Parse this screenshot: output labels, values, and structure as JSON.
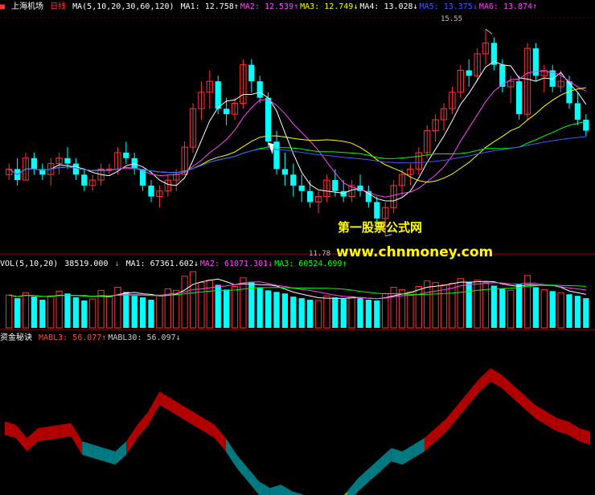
{
  "header": {
    "stock_name": "上海机场",
    "period": "日线",
    "ma_params": "MA(5,10,20,30,60,120)",
    "items": [
      {
        "label": "MA1:",
        "value": "12.758",
        "arrow": "↑",
        "color": "#ffffff"
      },
      {
        "label": "MA2:",
        "value": "12.539",
        "arrow": "↑",
        "color": "#ff44ff"
      },
      {
        "label": "MA3:",
        "value": "12.749",
        "arrow": "↓",
        "color": "#ffff00"
      },
      {
        "label": "MA4:",
        "value": "13.028",
        "arrow": "↓",
        "color": "#ffffff"
      },
      {
        "label": "MA5:",
        "value": "13.375",
        "arrow": "↓",
        "color": "#3a5cff"
      },
      {
        "label": "MA6:",
        "value": "13.874",
        "arrow": "↑",
        "color": "#ff44ff"
      }
    ]
  },
  "volume_header": {
    "params": "VOL(5,10,20)",
    "value": "38519.000",
    "arrow": "↓",
    "items": [
      {
        "label": "MA1:",
        "value": "67361.602",
        "arrow": "↓",
        "color": "#ffffff"
      },
      {
        "label": "MA2:",
        "value": "61071.301",
        "arrow": "↓",
        "color": "#ff44ff"
      },
      {
        "label": "MA3:",
        "value": "60524.699",
        "arrow": "↑",
        "color": "#00ff00"
      }
    ]
  },
  "indicator_header": {
    "name": "资金秘诀",
    "items": [
      {
        "label": "MABL3:",
        "value": "56.077",
        "arrow": "↑",
        "color": "#ff4444"
      },
      {
        "label": "MABL30:",
        "value": "56.097",
        "arrow": "↓",
        "color": "#cccccc"
      }
    ]
  },
  "annotations": {
    "high_label": "15.55",
    "low_label": "11.78"
  },
  "watermark": {
    "title": "第一股票公式网",
    "url": "www.chnmoney.com"
  },
  "colors": {
    "up": "#ff3333",
    "down": "#00ffff",
    "flow_red": "#b00000",
    "flow_teal": "#007a80",
    "flow_yellow": "#a0a000"
  },
  "chart_data": {
    "type": "candlestick",
    "price_low": 11.78,
    "price_high": 15.55,
    "ohlc": [
      [
        12.9,
        13.1,
        12.8,
        13.0
      ],
      [
        13.0,
        13.2,
        12.7,
        12.8
      ],
      [
        12.8,
        13.3,
        12.8,
        13.2
      ],
      [
        13.2,
        13.3,
        12.9,
        13.0
      ],
      [
        13.0,
        13.1,
        12.8,
        12.9
      ],
      [
        12.9,
        13.2,
        12.7,
        13.1
      ],
      [
        13.1,
        13.3,
        12.9,
        13.2
      ],
      [
        13.2,
        13.4,
        13.0,
        13.1
      ],
      [
        13.1,
        13.2,
        12.8,
        12.9
      ],
      [
        12.9,
        13.0,
        12.6,
        12.7
      ],
      [
        12.7,
        12.9,
        12.6,
        12.8
      ],
      [
        12.8,
        13.1,
        12.7,
        13.0
      ],
      [
        13.0,
        13.1,
        12.9,
        13.0
      ],
      [
        13.0,
        13.4,
        12.9,
        13.3
      ],
      [
        13.3,
        13.5,
        13.1,
        13.2
      ],
      [
        13.2,
        13.3,
        12.9,
        13.0
      ],
      [
        13.0,
        13.0,
        12.6,
        12.7
      ],
      [
        12.7,
        12.8,
        12.4,
        12.5
      ],
      [
        12.5,
        12.7,
        12.3,
        12.6
      ],
      [
        12.6,
        12.9,
        12.5,
        12.8
      ],
      [
        12.8,
        13.0,
        12.6,
        12.9
      ],
      [
        12.9,
        13.5,
        12.9,
        13.4
      ],
      [
        13.4,
        14.2,
        13.3,
        14.1
      ],
      [
        14.1,
        14.6,
        13.9,
        14.4
      ],
      [
        14.4,
        14.8,
        14.1,
        14.6
      ],
      [
        14.6,
        14.7,
        14.0,
        14.1
      ],
      [
        14.1,
        14.3,
        13.8,
        14.0
      ],
      [
        14.0,
        14.3,
        13.9,
        14.2
      ],
      [
        14.2,
        15.0,
        14.1,
        14.9
      ],
      [
        14.9,
        15.0,
        14.4,
        14.6
      ],
      [
        14.6,
        14.7,
        14.2,
        14.3
      ],
      [
        14.3,
        14.4,
        13.4,
        13.5
      ],
      [
        13.5,
        13.7,
        12.9,
        13.0
      ],
      [
        13.0,
        13.3,
        12.7,
        12.9
      ],
      [
        12.9,
        13.1,
        12.5,
        12.7
      ],
      [
        12.7,
        12.9,
        12.4,
        12.6
      ],
      [
        12.6,
        12.8,
        12.3,
        12.4
      ],
      [
        12.4,
        12.6,
        12.2,
        12.5
      ],
      [
        12.5,
        12.9,
        12.4,
        12.8
      ],
      [
        12.8,
        13.0,
        12.5,
        12.6
      ],
      [
        12.6,
        12.8,
        12.4,
        12.5
      ],
      [
        12.5,
        12.8,
        12.4,
        12.7
      ],
      [
        12.7,
        12.9,
        12.5,
        12.6
      ],
      [
        12.6,
        12.7,
        12.3,
        12.4
      ],
      [
        12.4,
        12.5,
        12.0,
        12.1
      ],
      [
        12.1,
        12.4,
        11.78,
        12.3
      ],
      [
        12.3,
        12.8,
        12.2,
        12.7
      ],
      [
        12.7,
        13.0,
        12.5,
        12.9
      ],
      [
        12.9,
        13.1,
        12.7,
        13.0
      ],
      [
        13.0,
        13.4,
        12.9,
        13.3
      ],
      [
        13.3,
        13.8,
        13.2,
        13.7
      ],
      [
        13.7,
        14.0,
        13.5,
        13.9
      ],
      [
        13.9,
        14.2,
        13.7,
        14.1
      ],
      [
        14.1,
        14.5,
        14.0,
        14.4
      ],
      [
        14.4,
        14.9,
        14.3,
        14.8
      ],
      [
        14.8,
        15.0,
        14.5,
        14.7
      ],
      [
        14.7,
        15.2,
        14.6,
        15.1
      ],
      [
        15.1,
        15.55,
        14.9,
        15.3
      ],
      [
        15.3,
        15.4,
        14.8,
        14.9
      ],
      [
        14.9,
        15.0,
        14.4,
        14.5
      ],
      [
        14.5,
        14.7,
        14.2,
        14.6
      ],
      [
        14.6,
        14.7,
        13.9,
        14.0
      ],
      [
        14.0,
        15.3,
        13.9,
        15.2
      ],
      [
        15.2,
        15.3,
        14.6,
        14.7
      ],
      [
        14.7,
        14.9,
        14.4,
        14.8
      ],
      [
        14.8,
        14.9,
        14.4,
        14.5
      ],
      [
        14.5,
        14.8,
        14.4,
        14.6
      ],
      [
        14.6,
        14.7,
        14.1,
        14.2
      ],
      [
        14.2,
        14.4,
        13.8,
        13.9
      ],
      [
        13.9,
        14.0,
        13.6,
        13.7
      ]
    ],
    "volume": [
      42,
      38,
      45,
      40,
      36,
      41,
      47,
      44,
      39,
      35,
      37,
      48,
      40,
      52,
      46,
      41,
      39,
      36,
      42,
      50,
      48,
      66,
      72,
      58,
      61,
      55,
      49,
      53,
      64,
      59,
      51,
      48,
      46,
      44,
      40,
      38,
      36,
      35,
      41,
      39,
      37,
      40,
      38,
      36,
      35,
      44,
      52,
      49,
      46,
      53,
      60,
      58,
      55,
      57,
      63,
      59,
      61,
      58,
      54,
      50,
      48,
      56,
      67,
      52,
      49,
      47,
      45,
      43,
      41,
      38
    ],
    "flow": [
      8,
      6,
      -2,
      4,
      5,
      6,
      7,
      -4,
      -6,
      -8,
      -10,
      -4,
      6,
      14,
      26,
      22,
      18,
      14,
      10,
      6,
      -2,
      -12,
      -20,
      -28,
      -32,
      -30,
      -34,
      -36,
      -38,
      -40,
      -42,
      -34,
      -26,
      -20,
      -14,
      -8,
      -10,
      -6,
      -2,
      4,
      10,
      18,
      26,
      34,
      40,
      36,
      30,
      24,
      18,
      14,
      10,
      8,
      4,
      2
    ]
  }
}
